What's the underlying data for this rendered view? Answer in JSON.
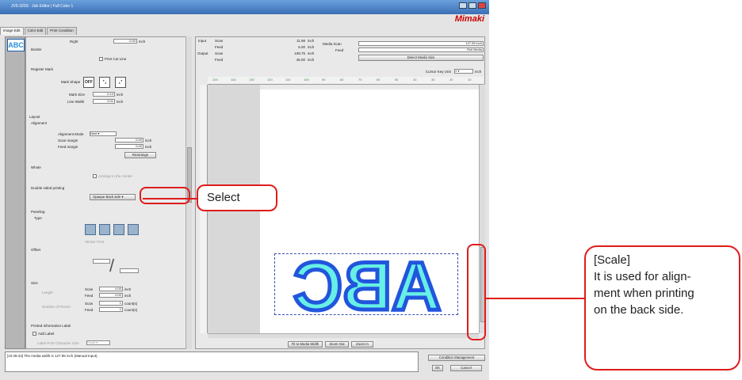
{
  "window": {
    "title": "JV5-320S : Job Editor | Full Color 1",
    "logo": "Mimaki"
  },
  "tabs": [
    "Image Edit",
    "Color Edit",
    "Print Condition"
  ],
  "thumbnail": {
    "text": "ABC"
  },
  "left_panel": {
    "right_label": "Right",
    "right_value": "0.00",
    "unit_inch": "inch",
    "border_label": "Border",
    "print_cut_line": "Print Cut Line",
    "register_mark": "Register Mark",
    "mark_shape_label": "Mark Shape",
    "mark_shape_off": "OFF",
    "mark_size_label": "Mark Size",
    "mark_size_value": "0.14",
    "line_width_label": "Line Width",
    "line_width_value": "0.01",
    "layout": "Layout",
    "alignment": "Alignment",
    "alignment_mode_label": "Alignment Mode",
    "alignment_mode_value": "Nest",
    "scan_margin_label": "Scan margin",
    "scan_margin_value": "0.00",
    "feed_margin_label": "Feed margin",
    "feed_margin_value": "0.00",
    "rearrange": "Rearrange",
    "whole": "Whole",
    "arrange_center": "Arrange in the Center",
    "double_sided_label": "Double sided printing",
    "double_sided_value": "Opaque Back side",
    "paneling": "Paneling",
    "type": "Type",
    "sticker_print": "Sticker Print",
    "offset": "Offset",
    "size": "Size",
    "by_length": "Length",
    "scan": "Scan",
    "feed": "Feed",
    "number_of_pieces": "Number of Pieces",
    "scan_len": "0.00",
    "feed_len": "0.00",
    "scan_count": "1",
    "feed_count": "1",
    "count_unit": "count(s)",
    "printed_info_label": "Printed Information Label",
    "add_label": "Add Label",
    "label_char_size": "Label Print Character Size",
    "label_char_size_value": "Small"
  },
  "right_panel": {
    "input_label": "Input",
    "output_label": "Output",
    "scan": "Scan",
    "feed": "Feed",
    "inch": "inch",
    "input_scan": "11.98",
    "input_feed": "5.00",
    "output_scan": "108.75",
    "output_feed": "45.00",
    "media_scan_label": "Media Scan",
    "media_feed_label": "Feed",
    "media_scan_value": "127.95 inch",
    "media_feed_value": "Roll Media",
    "detect_media_size": "Detect Media Size",
    "cursor_key_unit": "Cursor Key Unit",
    "cursor_key_value": "1",
    "cursor_key_inch": "inch",
    "ruler_ticks": [
      "100",
      "140",
      "130",
      "120",
      "110",
      "100",
      "90",
      "80",
      "70",
      "60",
      "50",
      "40",
      "30",
      "20",
      "10"
    ],
    "fit_media_width": "Fit to Media Width",
    "zoom_out": "Zoom Out",
    "zoom_in": "Zoom In",
    "preview_text": "ABC"
  },
  "log": {
    "message": "[10:39:43] The media width is 127.95 inch (Manual Input)."
  },
  "bottom_buttons": {
    "condition_management": "Condition Management",
    "ok": "OK",
    "cancel": "Cancel"
  },
  "callouts": {
    "select": "Select",
    "scale_title": "[Scale]",
    "scale_line1": "It is used for align-",
    "scale_line2": "ment when printing",
    "scale_line3": "on the back side."
  },
  "colors": {
    "accent_red": "#e01c1c",
    "preview_fill": "#66f0e6",
    "preview_stroke": "#2255dd",
    "logo_red": "#cc0000"
  }
}
